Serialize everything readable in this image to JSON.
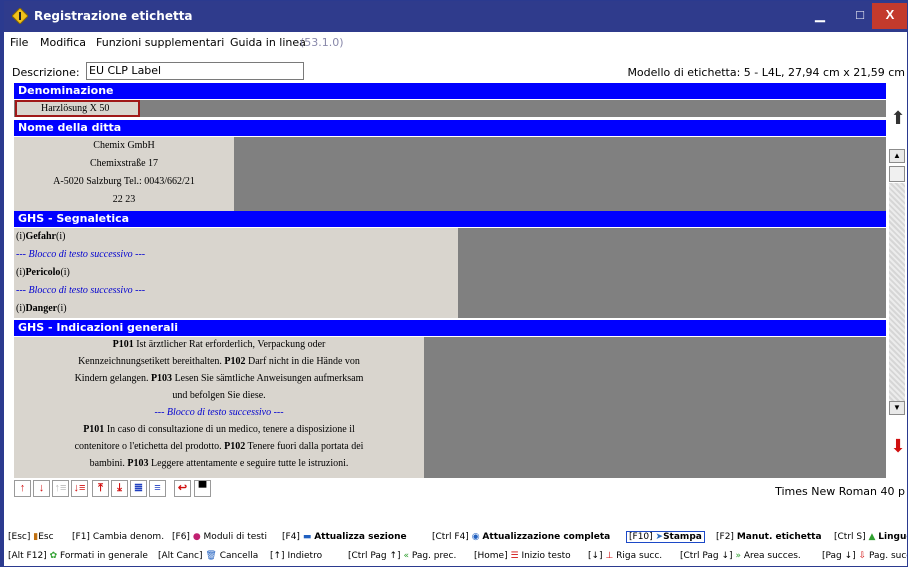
{
  "window": {
    "title": "Registrazione etichetta",
    "minimize": "▁",
    "maximize": "□",
    "close": "X"
  },
  "menu": {
    "file": "File",
    "edit": "Modifica",
    "extra": "Funzioni supplementari",
    "help": "Guida in linea",
    "version": "(53.1.0)"
  },
  "header": {
    "desc_label": "Descrizione:",
    "desc_value": "EU CLP Label",
    "model": "Modello di etichetta: 5 - L4L, 27,94 cm x 21,59 cm"
  },
  "sections": {
    "denominazione": {
      "title": "Denominazione",
      "value": "Harzlösung X 50"
    },
    "ditta": {
      "title": "Nome della ditta",
      "lines": [
        "Chemix GmbH",
        "Chemixstraße 17",
        "A-5020 Salzburg   Tel.: 0043/662/21",
        "22 23"
      ]
    },
    "ghs_signal": {
      "title": "GHS - Segnaletica",
      "row1_pre": "(i)",
      "row1_word": "Gefahr",
      "row1_post": "(i)",
      "block1": "--- Blocco di testo successivo ---",
      "row2_pre": "(i)",
      "row2_word": "Pericolo",
      "row2_post": "(i)",
      "block2": "--- Blocco di testo successivo ---",
      "row3_pre": "(i)",
      "row3_word": "Danger",
      "row3_post": "(i)"
    },
    "ghs_general": {
      "title": "GHS - Indicazioni generali",
      "l1_code": "P101",
      "l1_text": " Ist ärztlicher Rat erforderlich, Verpackung oder",
      "l2_text": "Kennzeichnungsetikett bereithalten. ",
      "l2_code": "P102",
      "l2_text2": " Darf nicht in die Hände von",
      "l3_text": "Kindern gelangen. ",
      "l3_code": "P103",
      "l3_text2": " Lesen Sie sämtliche Anweisungen aufmerksam",
      "l4_text": "und befolgen Sie diese.",
      "block": "--- Blocco di testo successivo ---",
      "l6_code": "P101",
      "l6_text": " In caso di consultazione di un medico, tenere a disposizione il",
      "l7_text": "contenitore o l'etichetta del prodotto. ",
      "l7_code": "P102",
      "l7_text2": " Tenere fuori dalla portata dei",
      "l8_text": "bambini. ",
      "l8_code": "P103",
      "l8_text2": " Leggere attentamente e seguire tutte le istruzioni."
    }
  },
  "status": {
    "font": "Times New Roman 40 p"
  },
  "fkeys1": [
    {
      "key": "[Esc]",
      "label": "Esc"
    },
    {
      "key": "[F1]",
      "label": "Cambia denom."
    },
    {
      "key": "[F6]",
      "label": "Moduli di testi"
    },
    {
      "key": "[F4]",
      "label": "Attualizza sezione"
    },
    {
      "key": "[Ctrl F4]",
      "label": "Attualizzazione completa"
    },
    {
      "key": "[F10]",
      "label": "Stampa"
    },
    {
      "key": "[F2]",
      "label": "Manut. etichetta"
    },
    {
      "key": "[Ctrl S]",
      "label": "Lingue"
    }
  ],
  "fkeys2": [
    {
      "key": "[Alt F12]",
      "label": "Formati in generale"
    },
    {
      "key": "[Alt Canc]",
      "label": "Cancella"
    },
    {
      "key": "[↑]",
      "label": "Indietro"
    },
    {
      "key": "[Ctrl Pag ↑]",
      "label": "Pag. prec."
    },
    {
      "key": "[Home]",
      "label": "Inizio testo"
    },
    {
      "key": "[↓]",
      "label": "Riga succ."
    },
    {
      "key": "[Ctrl Pag ↓]",
      "label": "Area succes."
    },
    {
      "key": "[Pag ↓]",
      "label": "Pag. succ"
    }
  ],
  "icons": [
    "diamond-app-icon",
    "arrow-up-icon",
    "arrow-down-icon",
    "print-icon",
    "undo-icon"
  ]
}
